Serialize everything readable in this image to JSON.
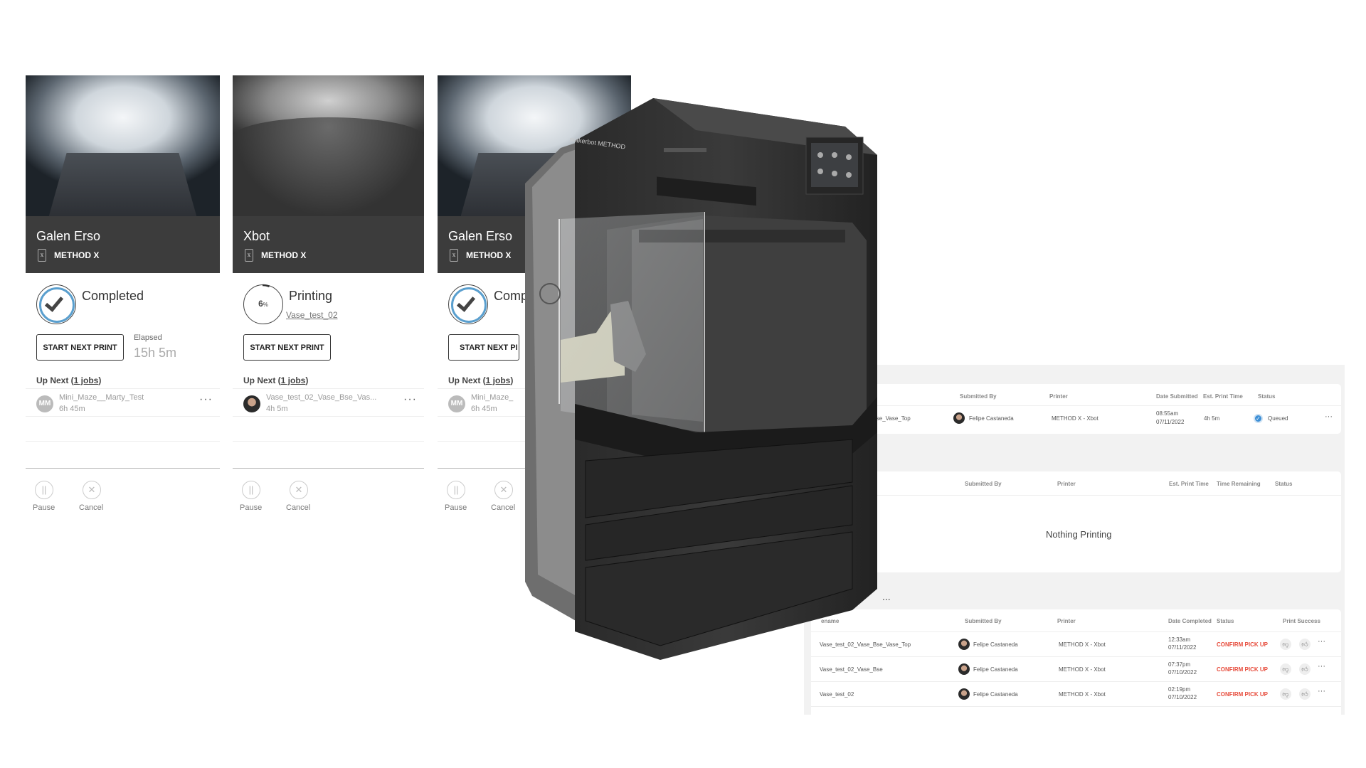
{
  "printers": [
    {
      "name": "Galen Erso",
      "model": "METHOD X",
      "status": "Completed",
      "status_icon": "check-circle-icon",
      "start_label": "START NEXT PRINT",
      "elapsed_label": "Elapsed",
      "elapsed_value": "15h 5m",
      "up_next_prefix": "Up Next (",
      "up_next_link": "1 jobs",
      "up_next_suffix": ")",
      "queue": [
        {
          "initials": "MM",
          "name": "Mini_Maze__Marty_Test",
          "time": "6h 45m"
        }
      ],
      "pause_label": "Pause",
      "cancel_label": "Cancel"
    },
    {
      "name": "Xbot",
      "model": "METHOD X",
      "status": "Printing",
      "progress_percent": 6,
      "progress_label": "6",
      "progress_unit": "%",
      "current_job": "Vase_test_02",
      "start_label": "START NEXT PRINT",
      "up_next_prefix": "Up Next (",
      "up_next_link": "1 jobs",
      "up_next_suffix": ")",
      "queue": [
        {
          "name": "Vase_test_02_Vase_Bse_Vas...",
          "time": "4h 5m"
        }
      ],
      "pause_label": "Pause",
      "cancel_label": "Cancel"
    },
    {
      "name": "Galen Erso",
      "model": "METHOD X",
      "status": "Comp",
      "status_icon": "check-circle-icon",
      "start_label": "START NEXT PI",
      "up_next_prefix": "Up Next (",
      "up_next_link": "1 jobs",
      "up_next_suffix": ")",
      "queue": [
        {
          "initials": "MM",
          "name": "Mini_Maze_",
          "time": "6h 45m"
        }
      ],
      "pause_label": "Pause",
      "cancel_label": "Cancel"
    }
  ],
  "printer_logo_text": "makerbot METHOD",
  "queued_table": {
    "headers": [
      "Submitted By",
      "Printer",
      "Date Submitted",
      "Est. Print Time",
      "Status"
    ],
    "rows": [
      {
        "filename": "02_Vase_Bse_Vase_Top",
        "submitted_by": "Felipe Castaneda",
        "printer": "METHOD X - Xbot",
        "time": "08:55am",
        "date": "07/11/2022",
        "est": "4h 5m",
        "status": "Queued"
      }
    ]
  },
  "printing_table": {
    "headers": [
      "Submitted By",
      "Printer",
      "Est. Print Time",
      "Time Remaining",
      "Status"
    ],
    "empty": "Nothing Printing"
  },
  "completed_table": {
    "more": "...",
    "headers": [
      "ename",
      "Submitted By",
      "Printer",
      "Date Completed",
      "Status",
      "Print Success"
    ],
    "rows": [
      {
        "filename": "Vase_test_02_Vase_Bse_Vase_Top",
        "submitted_by": "Felipe Castaneda",
        "printer": "METHOD X - Xbot",
        "time": "12:33am",
        "date": "07/11/2022",
        "status": "CONFIRM PICK UP"
      },
      {
        "filename": "Vase_test_02_Vase_Bse",
        "submitted_by": "Felipe Castaneda",
        "printer": "METHOD X - Xbot",
        "time": "07:37pm",
        "date": "07/10/2022",
        "status": "CONFIRM PICK UP"
      },
      {
        "filename": "Vase_test_02",
        "submitted_by": "Felipe Castaneda",
        "printer": "METHOD X - Xbot",
        "time": "02:19pm",
        "date": "07/10/2022",
        "status": "CONFIRM PICK UP"
      }
    ]
  },
  "colors": {
    "accent": "#5a9fce",
    "header_bg": "#3c3c3c",
    "alert": "#e74c3c",
    "panel_bg": "#f2f2f2"
  }
}
